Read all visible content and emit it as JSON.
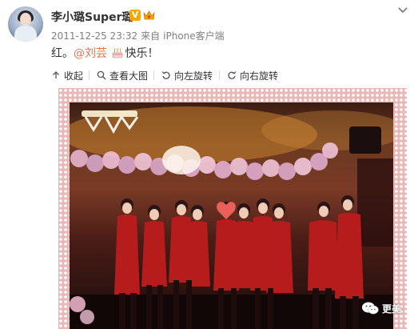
{
  "post": {
    "user_name": "李小璐Super璐",
    "timestamp": "2011-12-25 23:32",
    "source_prefix": "来自",
    "source": "iPhone客户端",
    "content": {
      "before": "红。",
      "mention": "@刘芸",
      "after": "快乐！"
    }
  },
  "toolbar": {
    "collapse": "收起",
    "view_large": "查看大图",
    "rotate_left": "向左旋转",
    "rotate_right": "向右旋转"
  },
  "watermark": {
    "label": "更美"
  },
  "colors": {
    "mention": "#eb7350",
    "verified_badge": "#f7a600",
    "frame_pink": "#e9b7b5",
    "meta_gray": "#808080"
  },
  "icons": [
    "avatar",
    "verified-badge-icon",
    "crown-icon",
    "chevron-down-icon",
    "cake-emoji-icon",
    "collapse-arrow-icon",
    "magnify-icon",
    "rotate-left-icon",
    "rotate-right-icon",
    "wechat-icon"
  ]
}
